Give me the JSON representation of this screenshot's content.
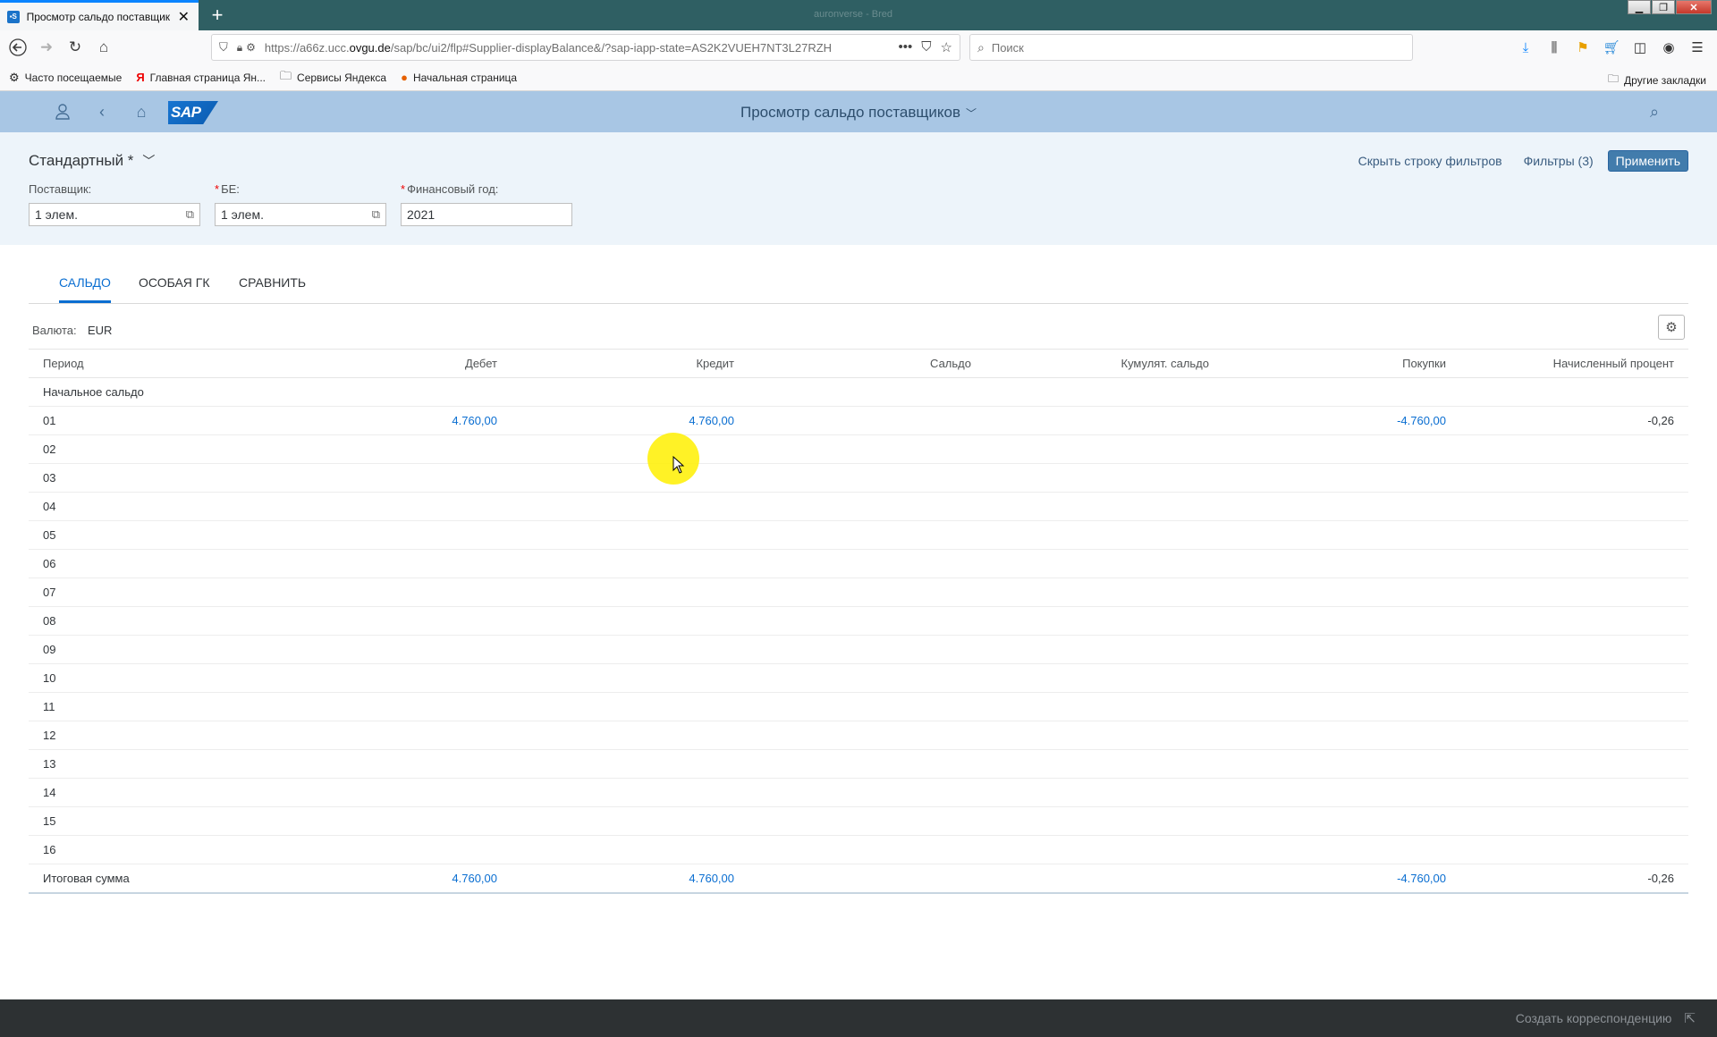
{
  "browser": {
    "tab_title": "Просмотр сальдо поставщик",
    "window_title": "auronverse - Bred",
    "url_prefix": "https://a66z.ucc.",
    "url_domain": "ovgu.de",
    "url_suffix": "/sap/bc/ui2/flp#Supplier-displayBalance&/?sap-iapp-state=AS2K2VUEH7NT3L27RZH",
    "search_placeholder": "Поиск",
    "bookmarks": [
      {
        "label": "Часто посещаемые",
        "icon": "gear-icon"
      },
      {
        "label": "Главная страница Ян...",
        "icon": "yandex-icon"
      },
      {
        "label": "Сервисы Яндекса",
        "icon": "folder-icon"
      },
      {
        "label": "Начальная страница",
        "icon": "firefox-icon"
      }
    ],
    "other_bookmarks": "Другие закладки"
  },
  "shell": {
    "logo_text": "SAP",
    "app_title": "Просмотр сальдо поставщиков"
  },
  "filterbar": {
    "variant": "Стандартный *",
    "hide_filterbar": "Скрыть строку фильтров",
    "filters": "Фильтры (3)",
    "apply": "Применить",
    "fields": [
      {
        "label": "Поставщик:",
        "required": false,
        "value": "1 элем."
      },
      {
        "label": "БЕ:",
        "required": true,
        "value": "1 элем."
      },
      {
        "label": "Финансовый год:",
        "required": true,
        "value": "2021"
      }
    ]
  },
  "tabs": [
    "САЛЬДО",
    "ОСОБАЯ ГК",
    "СРАВНИТЬ"
  ],
  "currency": {
    "label": "Валюта:",
    "value": "EUR"
  },
  "table": {
    "columns": [
      "Период",
      "Дебет",
      "Кредит",
      "Сальдо",
      "Кумулят. сальдо",
      "Покупки",
      "Начисленный процент"
    ],
    "rows": [
      [
        "Начальное сальдо",
        "",
        "",
        "",
        "",
        "",
        ""
      ],
      [
        "01",
        "4.760,00",
        "4.760,00",
        "",
        "",
        "-4.760,00",
        "-0,26"
      ],
      [
        "02",
        "",
        "",
        "",
        "",
        "",
        ""
      ],
      [
        "03",
        "",
        "",
        "",
        "",
        "",
        ""
      ],
      [
        "04",
        "",
        "",
        "",
        "",
        "",
        ""
      ],
      [
        "05",
        "",
        "",
        "",
        "",
        "",
        ""
      ],
      [
        "06",
        "",
        "",
        "",
        "",
        "",
        ""
      ],
      [
        "07",
        "",
        "",
        "",
        "",
        "",
        ""
      ],
      [
        "08",
        "",
        "",
        "",
        "",
        "",
        ""
      ],
      [
        "09",
        "",
        "",
        "",
        "",
        "",
        ""
      ],
      [
        "10",
        "",
        "",
        "",
        "",
        "",
        ""
      ],
      [
        "11",
        "",
        "",
        "",
        "",
        "",
        ""
      ],
      [
        "12",
        "",
        "",
        "",
        "",
        "",
        ""
      ],
      [
        "13",
        "",
        "",
        "",
        "",
        "",
        ""
      ],
      [
        "14",
        "",
        "",
        "",
        "",
        "",
        ""
      ],
      [
        "15",
        "",
        "",
        "",
        "",
        "",
        ""
      ],
      [
        "16",
        "",
        "",
        "",
        "",
        "",
        ""
      ],
      [
        "Итоговая сумма",
        "4.760,00",
        "4.760,00",
        "",
        "",
        "-4.760,00",
        "-0,26"
      ]
    ]
  },
  "footer": {
    "action": "Создать корреспонденцию"
  },
  "colors": {
    "shell": "#a8c6e4",
    "filterbar": "#edf4fa",
    "accent": "#0a6ed1",
    "apply": "#427cac",
    "footer": "#2d3133"
  }
}
